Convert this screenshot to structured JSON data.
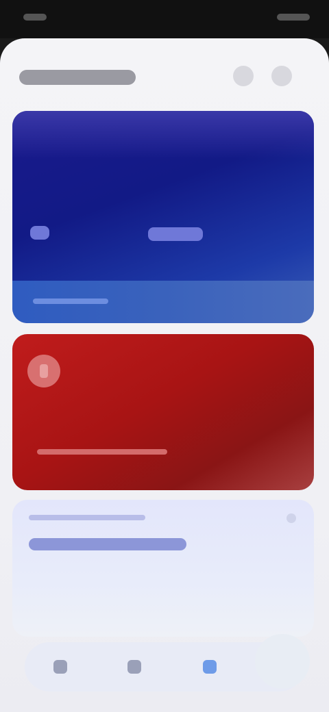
{
  "statusbar": {},
  "header": {
    "title": "",
    "icons": [
      "search-icon",
      "more-icon"
    ]
  },
  "cards": {
    "blue": {
      "accent": "#1a1a8c"
    },
    "red": {
      "accent": "#b01818",
      "icon": "document-icon"
    }
  },
  "promo": {},
  "tabs": {
    "icons": [
      "home-icon",
      "list-icon",
      "favorites-icon",
      "profile-icon"
    ],
    "active_index": 2
  }
}
